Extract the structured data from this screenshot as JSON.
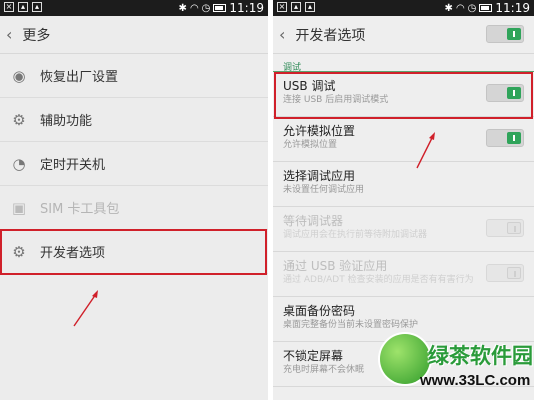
{
  "status_bar": {
    "time": "11:19"
  },
  "left": {
    "header": {
      "back_icon": "back-chevron",
      "title": "更多"
    },
    "items": [
      {
        "label": "恢复出厂设置",
        "icon": "reset-icon",
        "enabled": true
      },
      {
        "label": "辅助功能",
        "icon": "accessibility-gear-icon",
        "enabled": true
      },
      {
        "label": "定时开关机",
        "icon": "timer-power-icon",
        "enabled": true
      },
      {
        "label": "SIM 卡工具包",
        "icon": "sim-card-icon",
        "enabled": false
      },
      {
        "label": "开发者选项",
        "icon": "developer-gear-icon",
        "enabled": true
      }
    ]
  },
  "right": {
    "header": {
      "title": "开发者选项",
      "master_toggle": true
    },
    "section": "调试",
    "settings": [
      {
        "title": "USB 调试",
        "desc": "连接 USB 后启用调试模式",
        "toggle": true,
        "enabled": true
      },
      {
        "title": "允许模拟位置",
        "desc": "允许模拟位置",
        "toggle": true,
        "enabled": true
      },
      {
        "title": "选择调试应用",
        "desc": "未设置任何调试应用",
        "toggle": null,
        "enabled": true
      },
      {
        "title": "等待调试器",
        "desc": "调试应用会在执行前等待附加调试器",
        "toggle": false,
        "enabled": false
      },
      {
        "title": "通过 USB 验证应用",
        "desc": "通过 ADB/ADT 检查安装的应用是否有有害行为",
        "toggle": true,
        "enabled": false
      },
      {
        "title": "桌面备份密码",
        "desc": "桌面完整备份当前未设置密码保护",
        "toggle": null,
        "enabled": true
      },
      {
        "title": "不锁定屏幕",
        "desc": "充电时屏幕不会休眠",
        "toggle": null,
        "enabled": true
      }
    ]
  },
  "watermark": {
    "title": "绿茶软件园",
    "url": "www.33LC.com"
  },
  "colors": {
    "highlight": "#d0202a",
    "toggle_on": "#2fa45a",
    "status_bar": "#1c1c1c"
  }
}
